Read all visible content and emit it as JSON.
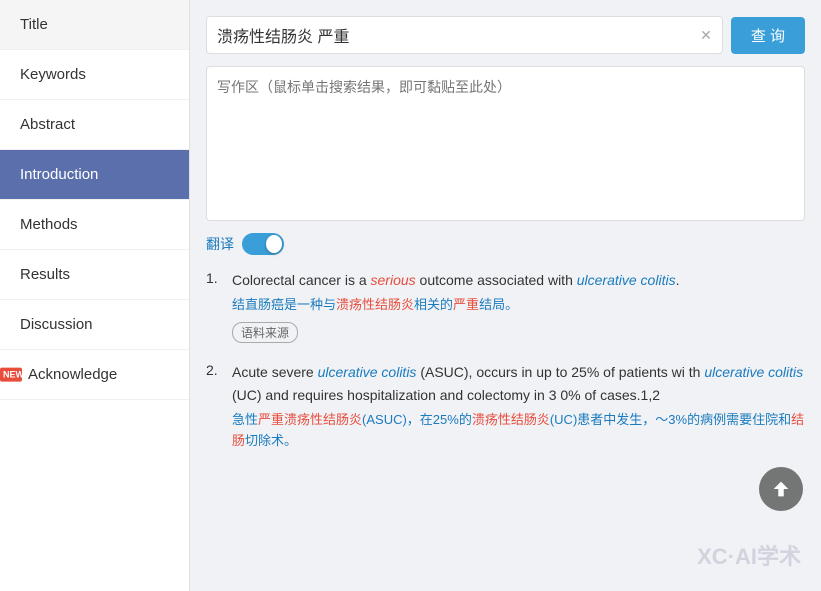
{
  "sidebar": {
    "items": [
      {
        "id": "title",
        "label": "Title",
        "active": false,
        "newBadge": false
      },
      {
        "id": "keywords",
        "label": "Keywords",
        "active": false,
        "newBadge": false
      },
      {
        "id": "abstract",
        "label": "Abstract",
        "active": false,
        "newBadge": false
      },
      {
        "id": "introduction",
        "label": "Introduction",
        "active": true,
        "newBadge": false
      },
      {
        "id": "methods",
        "label": "Methods",
        "active": false,
        "newBadge": false
      },
      {
        "id": "results",
        "label": "Results",
        "active": false,
        "newBadge": false
      },
      {
        "id": "discussion",
        "label": "Discussion",
        "active": false,
        "newBadge": false
      },
      {
        "id": "acknowledge",
        "label": "Acknowledge",
        "active": false,
        "newBadge": true
      }
    ]
  },
  "search": {
    "query": "溃疡性结肠炎 严重",
    "button_label": "查 询",
    "clear_title": "clear"
  },
  "textarea": {
    "placeholder": "写作区（鼠标单击搜索结果，即可黏贴至此处）"
  },
  "translate": {
    "label": "翻译"
  },
  "new_badge_text": "NEW",
  "results": [
    {
      "num": "1.",
      "en_parts": [
        {
          "text": "Colorectal cancer is a ",
          "style": "normal"
        },
        {
          "text": "serious",
          "style": "red-italic"
        },
        {
          "text": " outcome associated with ",
          "style": "normal"
        },
        {
          "text": "ulcerative colitis",
          "style": "blue-italic"
        },
        {
          "text": ".",
          "style": "normal"
        }
      ],
      "zh_parts": [
        {
          "text": "结直肠癌是一种与",
          "style": "normal"
        },
        {
          "text": "溃疡性结肠炎",
          "style": "red"
        },
        {
          "text": "相关的",
          "style": "normal"
        },
        {
          "text": "严重",
          "style": "red"
        },
        {
          "text": "结局。",
          "style": "normal"
        }
      ],
      "source_tag": "语料来源"
    },
    {
      "num": "2.",
      "en_parts": [
        {
          "text": "Acute severe ",
          "style": "normal"
        },
        {
          "text": "ulcerative colitis",
          "style": "blue-italic"
        },
        {
          "text": " (ASUC), occurs in up to 25% of patients with ",
          "style": "normal"
        },
        {
          "text": "ulcerative colitis",
          "style": "blue-italic"
        },
        {
          "text": " (UC) and requires hospitalization and colectomy in 30% of cases.1,2",
          "style": "normal"
        }
      ],
      "zh_parts": [
        {
          "text": "急性",
          "style": "normal"
        },
        {
          "text": "严重溃疡性结肠炎",
          "style": "red"
        },
        {
          "text": "(ASUC)，在25%的",
          "style": "normal"
        },
        {
          "text": "溃疡性结肠炎",
          "style": "red"
        },
        {
          "text": "(UC)患者中发生，",
          "style": "normal"
        },
        {
          "text": "～3%的",
          "style": "normal"
        },
        {
          "text": "病例需要住院和",
          "style": "normal"
        },
        {
          "text": "结肠",
          "style": "red"
        },
        {
          "text": "切除术。",
          "style": "normal"
        }
      ],
      "source_tag": null
    }
  ],
  "watermark": "XC·AI学术"
}
